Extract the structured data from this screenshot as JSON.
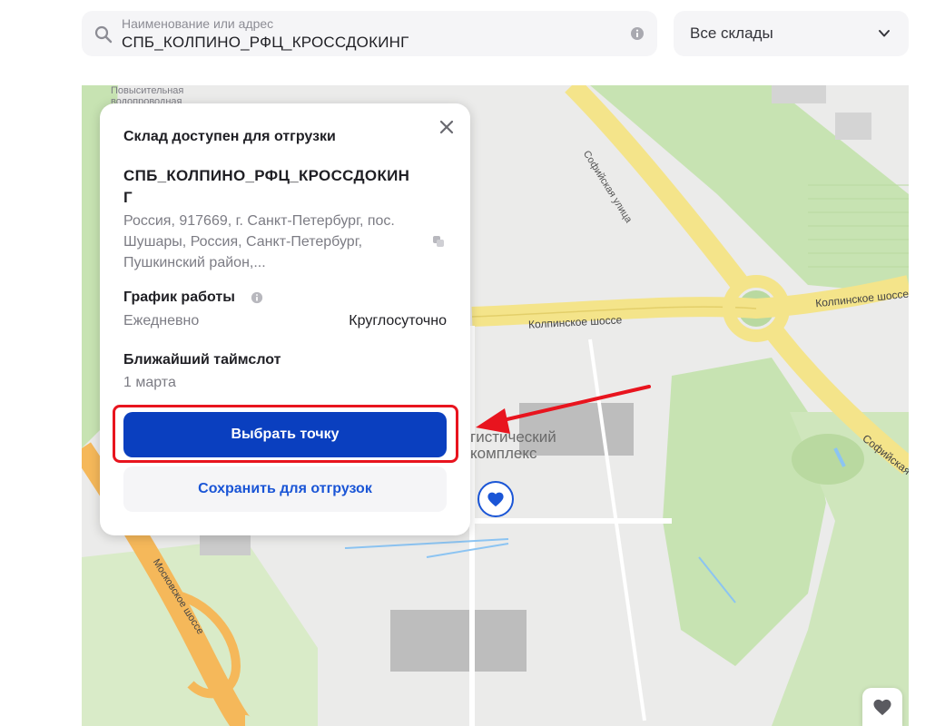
{
  "search": {
    "placeholder": "Наименование или адрес",
    "value": "СПБ_КОЛПИНО_РФЦ_КРОССДОКИНГ"
  },
  "filter": {
    "selected": "Все склады"
  },
  "map": {
    "labels": {
      "village": "Повысительная водопроводная",
      "street1": "Софийская улица",
      "street2": "Колпинское шоссе",
      "street3": "Колпинское шоссе",
      "street4": "Софийская",
      "street5": "Московское шоссе",
      "complex_line1": "гистический",
      "complex_line2": "комплекс"
    },
    "colors": {
      "background": "#ebebea",
      "green": "#c7e3b2",
      "road_yellow": "#f4e48a",
      "road_orange": "#f5b85a",
      "building": "#bdbdbd",
      "water": "#8cc4f2"
    }
  },
  "popup": {
    "header": "Склад доступен для отгрузки",
    "warehouse_name": "СПБ_КОЛПИНО_РФЦ_КРОССДОКИНГ",
    "address": "Россия, 917669, г. Санкт-Петербург, пос. Шушары, Россия, Санкт-Петербург, Пушкинский район,...",
    "schedule_title": "График работы",
    "schedule_days": "Ежедневно",
    "schedule_hours": "Круглосуточно",
    "timeslot_title": "Ближайший таймслот",
    "timeslot_value": "1 марта",
    "choose_button": "Выбрать точку",
    "save_button": "Сохранить для отгрузок"
  },
  "icons": {
    "search": "search-icon",
    "info": "info-icon",
    "chevron": "chevron-down-icon",
    "close": "close-icon",
    "copy": "copy-icon",
    "marker": "heart-icon",
    "favorites": "heart-icon"
  },
  "colors": {
    "primary_button": "#0a3fbf",
    "link_blue": "#1a55d6",
    "highlight_red": "#e8141e"
  }
}
